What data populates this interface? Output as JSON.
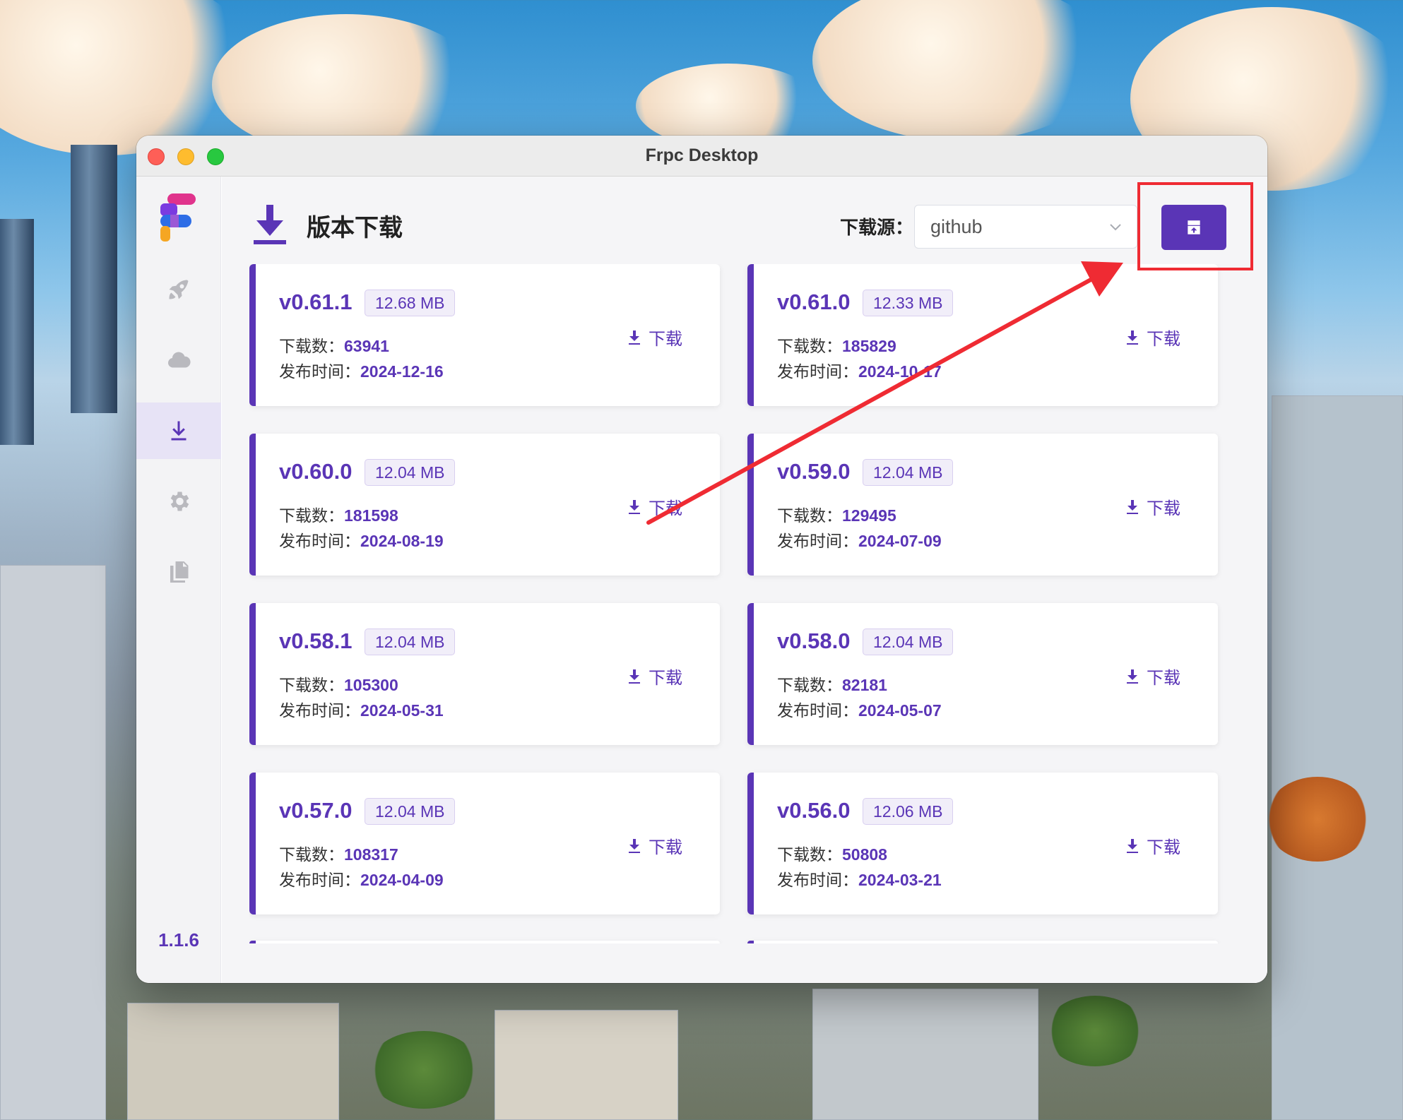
{
  "window": {
    "title": "Frpc Desktop"
  },
  "sidebar": {
    "items": [
      {
        "name": "rocket-icon"
      },
      {
        "name": "cloud-icon"
      },
      {
        "name": "download-icon",
        "active": true
      },
      {
        "name": "gear-icon"
      },
      {
        "name": "copy-icon"
      }
    ],
    "version": "1.1.6"
  },
  "header": {
    "title": "版本下载",
    "source_label": "下载源：",
    "source_value": "github"
  },
  "labels": {
    "downloads": "下载数：",
    "published": "发布时间：",
    "download_action": "下载"
  },
  "releases": [
    {
      "version": "v0.61.1",
      "size": "12.68 MB",
      "downloads": "63941",
      "date": "2024-12-16"
    },
    {
      "version": "v0.61.0",
      "size": "12.33 MB",
      "downloads": "185829",
      "date": "2024-10-17"
    },
    {
      "version": "v0.60.0",
      "size": "12.04 MB",
      "downloads": "181598",
      "date": "2024-08-19"
    },
    {
      "version": "v0.59.0",
      "size": "12.04 MB",
      "downloads": "129495",
      "date": "2024-07-09"
    },
    {
      "version": "v0.58.1",
      "size": "12.04 MB",
      "downloads": "105300",
      "date": "2024-05-31"
    },
    {
      "version": "v0.58.0",
      "size": "12.04 MB",
      "downloads": "82181",
      "date": "2024-05-07"
    },
    {
      "version": "v0.57.0",
      "size": "12.04 MB",
      "downloads": "108317",
      "date": "2024-04-09"
    },
    {
      "version": "v0.56.0",
      "size": "12.06 MB",
      "downloads": "50808",
      "date": "2024-03-21"
    }
  ],
  "colors": {
    "accent": "#5a35b6",
    "annotation": "#ef2b33"
  }
}
